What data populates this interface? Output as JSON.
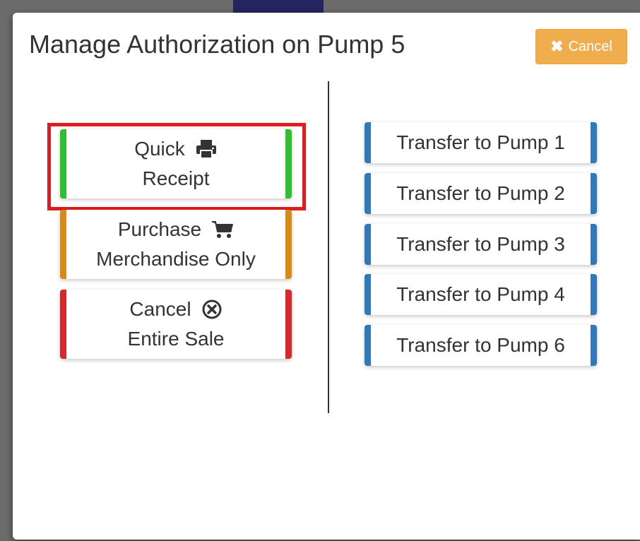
{
  "modal": {
    "title": "Manage Authorization on Pump 5",
    "cancel_label": "Cancel",
    "cancel_icon": "times-icon"
  },
  "actions": [
    {
      "line1": "Quick",
      "line2": "Receipt",
      "icon": "printer-icon",
      "color": "#2fbf2f"
    },
    {
      "line1": "Purchase",
      "line2": "Merchandise Only",
      "icon": "shopping-cart-icon",
      "color": "#d98a14"
    },
    {
      "line1": "Cancel",
      "line2": "Entire Sale",
      "icon": "cancel-circle-icon",
      "color": "#d9272b"
    }
  ],
  "transfers": [
    {
      "label": "Transfer to Pump 1"
    },
    {
      "label": "Transfer to Pump 2"
    },
    {
      "label": "Transfer to Pump 3"
    },
    {
      "label": "Transfer to Pump 4"
    },
    {
      "label": "Transfer to Pump 6"
    }
  ],
  "colors": {
    "warning": "#f0ad4e",
    "transfer_accent": "#3377bb",
    "highlight": "#e01b22"
  }
}
